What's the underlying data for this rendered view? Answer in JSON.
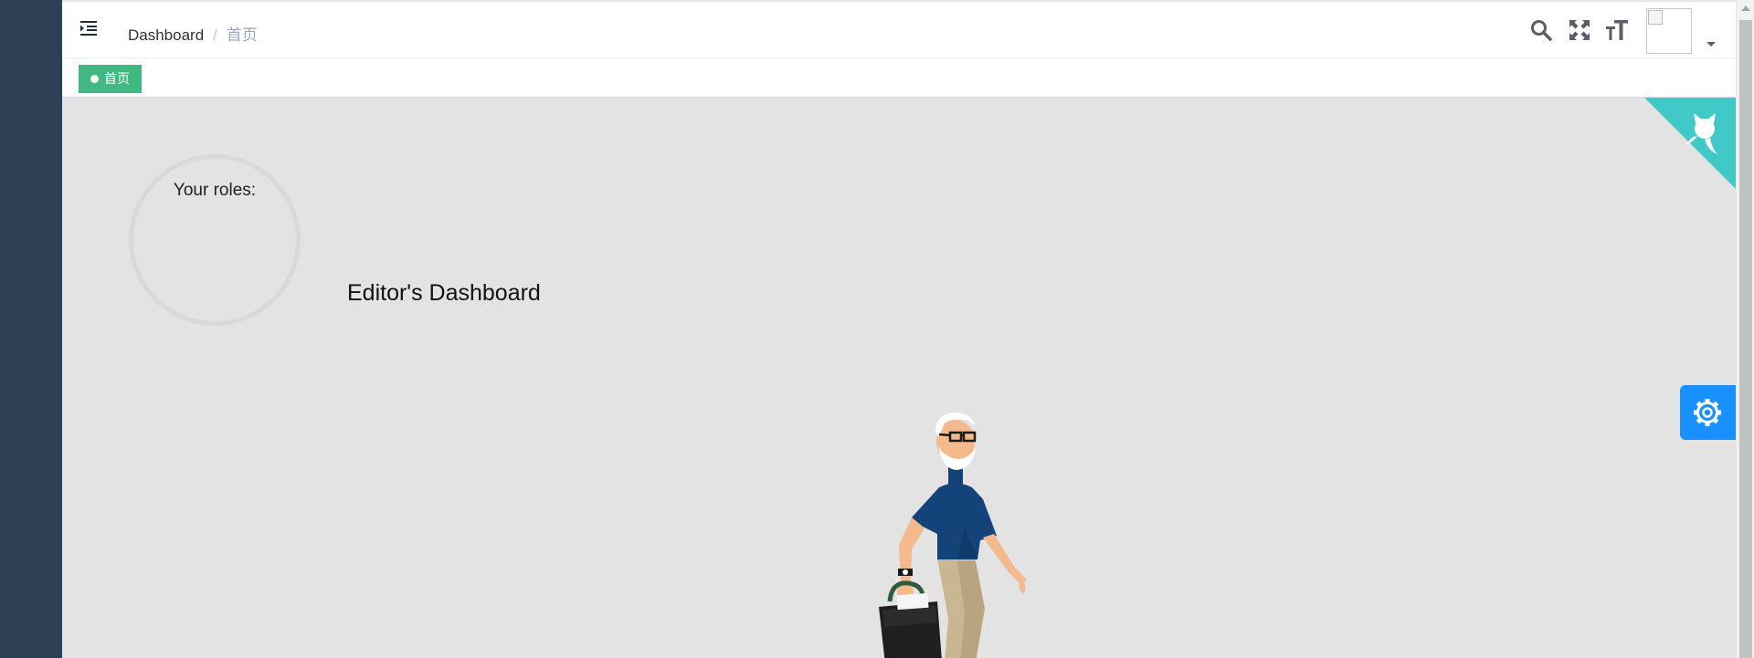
{
  "breadcrumb": {
    "root": "Dashboard",
    "separator": "/",
    "current": "首页"
  },
  "tags": [
    {
      "label": "首页",
      "active": true
    }
  ],
  "navbar_icons": [
    "hamburger-icon",
    "search-icon",
    "fullscreen-icon",
    "font-size-icon"
  ],
  "dashboard": {
    "roles_label": "Your roles:",
    "title": "Editor's Dashboard"
  },
  "colors": {
    "sidebar": "#2f3f55",
    "content_bg": "#e3e3e3",
    "tag_active": "#42b983",
    "github_corner": "#40c9c6",
    "settings_button": "#1890ff"
  }
}
